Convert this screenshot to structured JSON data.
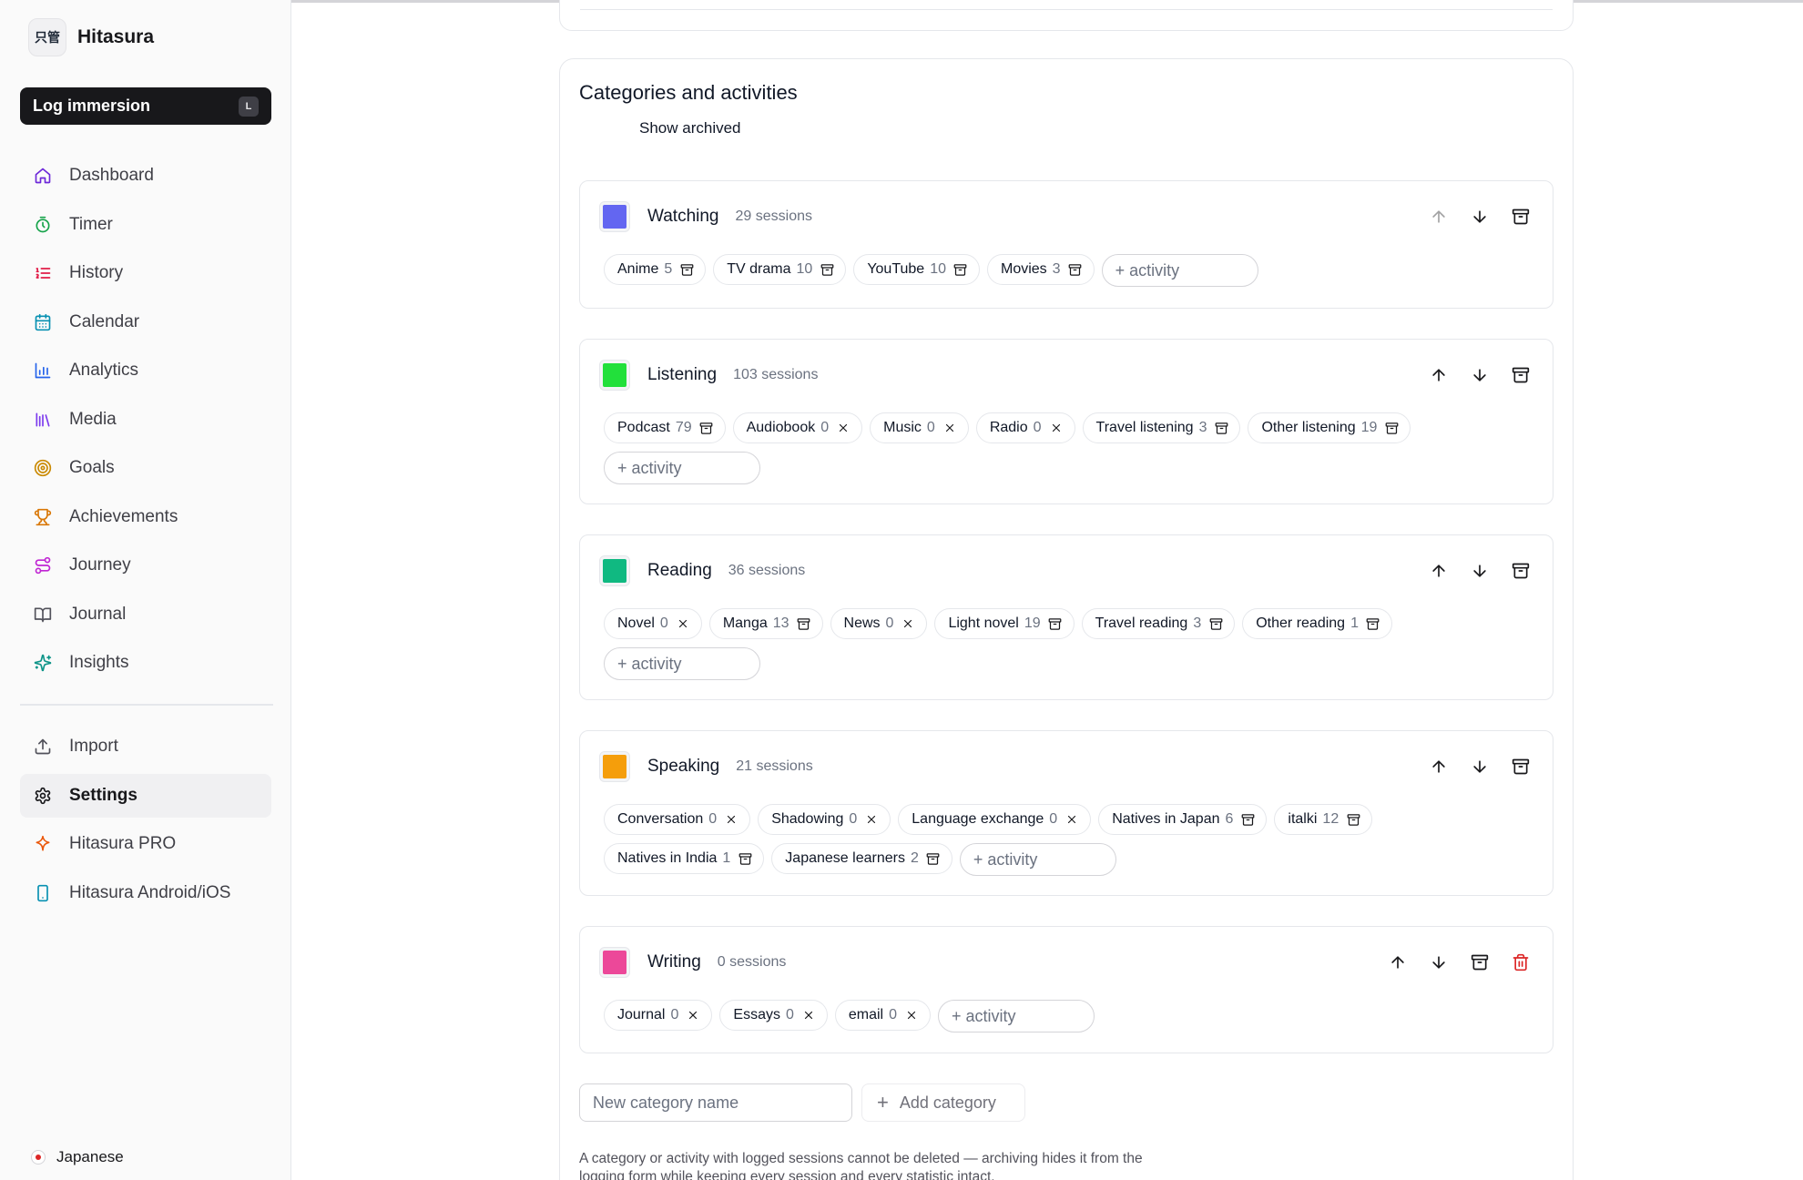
{
  "app": {
    "name": "Hitasura",
    "logo_text": "只管"
  },
  "sidebar": {
    "log_button": {
      "label": "Log immersion",
      "shortcut": "L"
    },
    "nav": [
      {
        "label": "Dashboard",
        "icon": "home-icon",
        "color": "#6d28d9"
      },
      {
        "label": "Timer",
        "icon": "timer-icon",
        "color": "#16a34a"
      },
      {
        "label": "History",
        "icon": "list-ordered-icon",
        "color": "#e11d48"
      },
      {
        "label": "Calendar",
        "icon": "calendar-icon",
        "color": "#0891b2"
      },
      {
        "label": "Analytics",
        "icon": "bar-chart-icon",
        "color": "#2563eb"
      },
      {
        "label": "Media",
        "icon": "library-icon",
        "color": "#7c3aed"
      },
      {
        "label": "Goals",
        "icon": "target-icon",
        "color": "#ca8a04"
      },
      {
        "label": "Achievements",
        "icon": "trophy-icon",
        "color": "#d97706"
      },
      {
        "label": "Journey",
        "icon": "route-icon",
        "color": "#c026d3"
      },
      {
        "label": "Journal",
        "icon": "book-open-icon",
        "color": "#52525b"
      },
      {
        "label": "Insights",
        "icon": "sparkles-icon",
        "color": "#0d9488"
      }
    ],
    "nav_bottom": [
      {
        "label": "Import",
        "icon": "upload-icon",
        "color": "#52525b"
      },
      {
        "label": "Settings",
        "icon": "gear-icon",
        "color": "#18181b",
        "active": true
      },
      {
        "label": "Hitasura PRO",
        "icon": "sparkle-icon",
        "color": "#ea580c"
      },
      {
        "label": "Hitasura Android/iOS",
        "icon": "smartphone-icon",
        "color": "#0891b2"
      }
    ],
    "language": "Japanese"
  },
  "main": {
    "title": "Categories and activities",
    "show_archived": "Show archived",
    "add_activity_placeholder": "+ activity",
    "new_category_placeholder": "New category name",
    "add_category_label": "Add category",
    "footnote": "A category or activity with logged sessions cannot be deleted — archiving hides it from the logging form while keeping every session and every statistic intact.",
    "categories": [
      {
        "name": "Watching",
        "sessions": "29 sessions",
        "color": "#6366f1",
        "can_move_up": false,
        "deletable": false,
        "activities": [
          {
            "name": "Anime",
            "count": "5",
            "action": "archive"
          },
          {
            "name": "TV drama",
            "count": "10",
            "action": "archive"
          },
          {
            "name": "YouTube",
            "count": "10",
            "action": "archive"
          },
          {
            "name": "Movies",
            "count": "3",
            "action": "archive"
          }
        ]
      },
      {
        "name": "Listening",
        "sessions": "103 sessions",
        "color": "#22e03b",
        "can_move_up": true,
        "deletable": false,
        "activities": [
          {
            "name": "Podcast",
            "count": "79",
            "action": "archive"
          },
          {
            "name": "Audiobook",
            "count": "0",
            "action": "delete"
          },
          {
            "name": "Music",
            "count": "0",
            "action": "delete"
          },
          {
            "name": "Radio",
            "count": "0",
            "action": "delete"
          },
          {
            "name": "Travel listening",
            "count": "3",
            "action": "archive"
          },
          {
            "name": "Other listening",
            "count": "19",
            "action": "archive"
          }
        ]
      },
      {
        "name": "Reading",
        "sessions": "36 sessions",
        "color": "#10b981",
        "can_move_up": true,
        "deletable": false,
        "activities": [
          {
            "name": "Novel",
            "count": "0",
            "action": "delete"
          },
          {
            "name": "Manga",
            "count": "13",
            "action": "archive"
          },
          {
            "name": "News",
            "count": "0",
            "action": "delete"
          },
          {
            "name": "Light novel",
            "count": "19",
            "action": "archive"
          },
          {
            "name": "Travel reading",
            "count": "3",
            "action": "archive"
          },
          {
            "name": "Other reading",
            "count": "1",
            "action": "archive"
          }
        ]
      },
      {
        "name": "Speaking",
        "sessions": "21 sessions",
        "color": "#f59e0b",
        "can_move_up": true,
        "deletable": false,
        "activities": [
          {
            "name": "Conversation",
            "count": "0",
            "action": "delete"
          },
          {
            "name": "Shadowing",
            "count": "0",
            "action": "delete"
          },
          {
            "name": "Language exchange",
            "count": "0",
            "action": "delete"
          },
          {
            "name": "Natives in Japan",
            "count": "6",
            "action": "archive"
          },
          {
            "name": "italki",
            "count": "12",
            "action": "archive"
          },
          {
            "name": "Natives in India",
            "count": "1",
            "action": "archive"
          },
          {
            "name": "Japanese learners",
            "count": "2",
            "action": "archive"
          }
        ]
      },
      {
        "name": "Writing",
        "sessions": "0 sessions",
        "color": "#ec4899",
        "can_move_up": true,
        "deletable": true,
        "activities": [
          {
            "name": "Journal",
            "count": "0",
            "action": "delete"
          },
          {
            "name": "Essays",
            "count": "0",
            "action": "delete"
          },
          {
            "name": "email",
            "count": "0",
            "action": "delete"
          }
        ]
      }
    ]
  }
}
